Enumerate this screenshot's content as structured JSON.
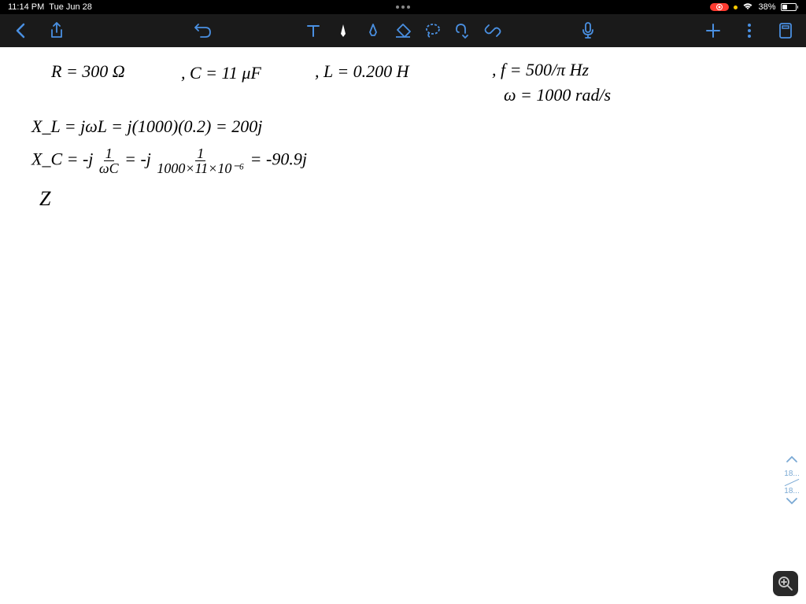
{
  "status": {
    "time": "11:14 PM",
    "date": "Tue Jun 28",
    "battery_pct": "38%"
  },
  "toolbar": {
    "back": "Back",
    "share": "Share",
    "undo": "Undo",
    "text_tool": "Text",
    "pen_tool": "Pen",
    "highlighter": "Highlighter",
    "eraser": "Eraser",
    "lasso": "Lasso",
    "hand": "Hand",
    "link": "Link",
    "mic": "Microphone",
    "add": "Add",
    "more": "More",
    "pages": "Pages"
  },
  "handwriting": {
    "line1_r": "R = 300 Ω",
    "line1_c": ", C = 11 μF",
    "line1_l": ", L = 0.200 H",
    "line1_f": ", f = 500/π Hz",
    "line1_w": "ω = 1000 rad/s",
    "line2": "X_L = jωL = j(1000)(0.2) = 200j",
    "line3_a": "X_C = -j",
    "line3_frac1_num": "1",
    "line3_frac1_den": "ωC",
    "line3_b": " = -j",
    "line3_frac2_num": "1",
    "line3_frac2_den": "1000×11×10⁻⁶",
    "line3_c": " = -90.9j",
    "line4": "Z"
  },
  "page_nav": {
    "current": "18...",
    "total": "18..."
  }
}
